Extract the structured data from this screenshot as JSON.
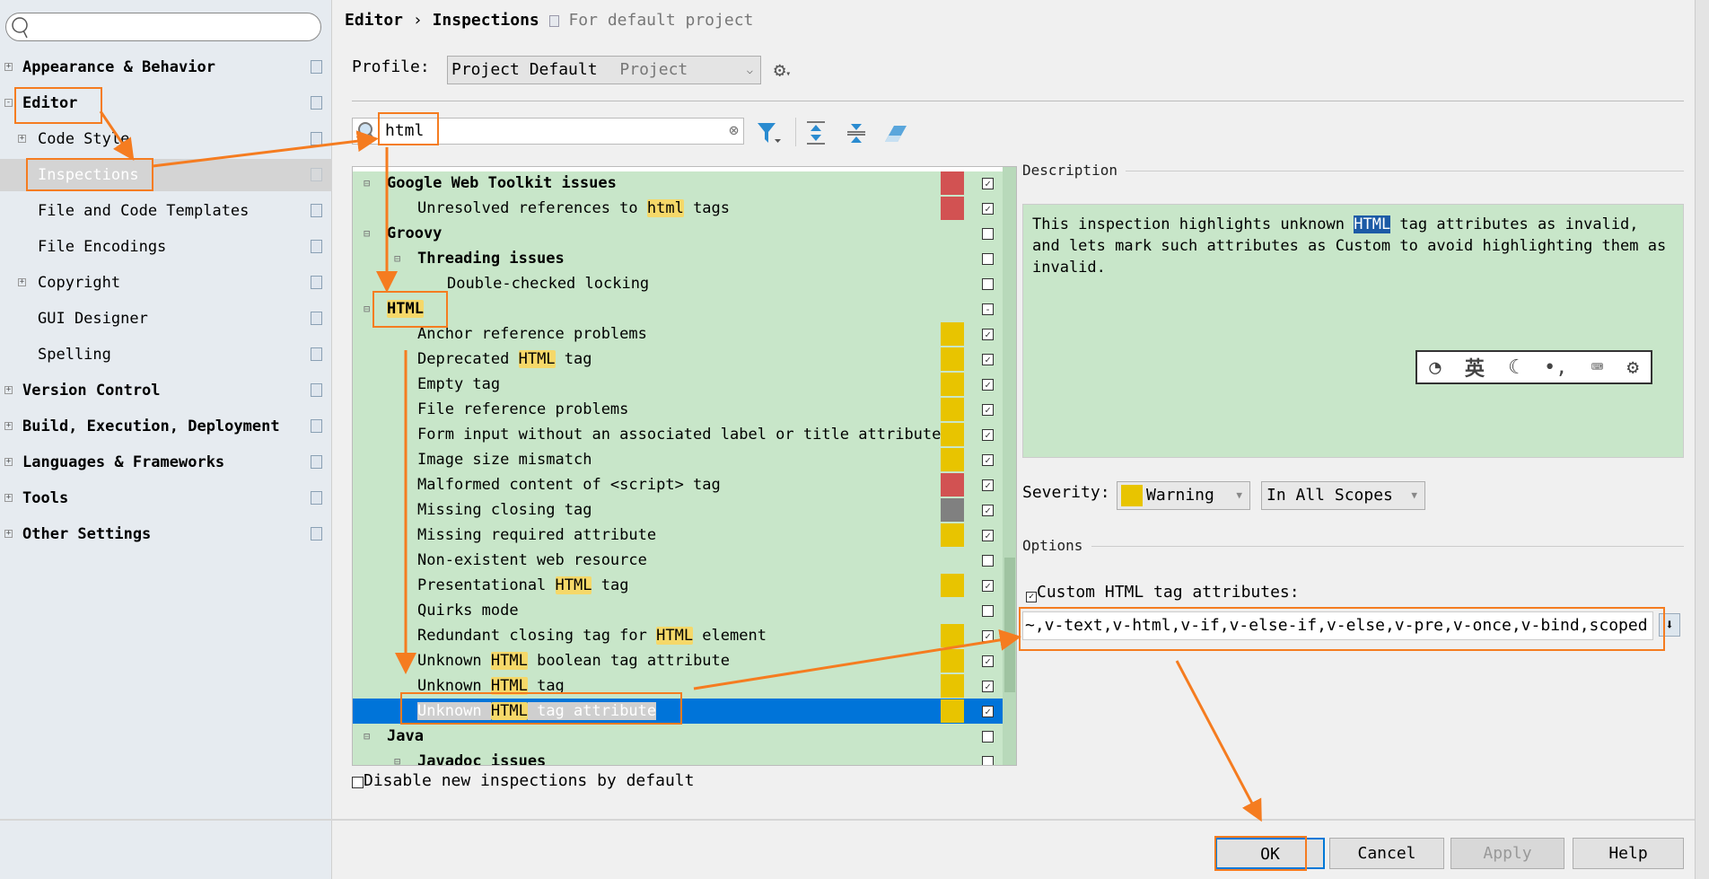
{
  "sidebar": {
    "search_placeholder": "",
    "items": [
      {
        "label": "Appearance & Behavior",
        "level": 0,
        "expander": "+"
      },
      {
        "label": "Editor",
        "level": 0,
        "expander": "-"
      },
      {
        "label": "Code Style",
        "level": 1,
        "expander": "+"
      },
      {
        "label": "Inspections",
        "level": 1,
        "expander": "",
        "selected": true
      },
      {
        "label": "File and Code Templates",
        "level": 1,
        "expander": ""
      },
      {
        "label": "File Encodings",
        "level": 1,
        "expander": ""
      },
      {
        "label": "Copyright",
        "level": 1,
        "expander": "+"
      },
      {
        "label": "GUI Designer",
        "level": 1,
        "expander": ""
      },
      {
        "label": "Spelling",
        "level": 1,
        "expander": ""
      },
      {
        "label": "Version Control",
        "level": 0,
        "expander": "+"
      },
      {
        "label": "Build, Execution, Deployment",
        "level": 0,
        "expander": "+"
      },
      {
        "label": "Languages & Frameworks",
        "level": 0,
        "expander": "+"
      },
      {
        "label": "Tools",
        "level": 0,
        "expander": "+"
      },
      {
        "label": "Other Settings",
        "level": 0,
        "expander": "+"
      }
    ]
  },
  "header": {
    "crumb1": "Editor",
    "sep": "›",
    "crumb2": "Inspections",
    "scope": "For default project"
  },
  "profile": {
    "label": "Profile:",
    "value": "Project Default",
    "type": "Project"
  },
  "filter": {
    "value": "html"
  },
  "colors": {
    "error": "#d25252",
    "warning": "#e8c400",
    "server": "#808080",
    "selection": "#0074d9",
    "tree_bg": "#c8e6c9",
    "annotation": "#f57c20"
  },
  "tree": [
    {
      "level": 0,
      "bold": true,
      "parts": [
        [
          "Google Web Toolkit issues",
          0
        ]
      ],
      "sev": "error",
      "check": "on"
    },
    {
      "level": 1,
      "parts": [
        [
          "Unresolved references to ",
          0
        ],
        [
          "html",
          1
        ],
        [
          " tags",
          0
        ]
      ],
      "sev": "error",
      "check": "on"
    },
    {
      "level": 0,
      "bold": true,
      "parts": [
        [
          "Groovy",
          0
        ]
      ],
      "sev": "",
      "check": "off"
    },
    {
      "level": 1,
      "bold": true,
      "parts": [
        [
          "Threading issues",
          0
        ]
      ],
      "sev": "",
      "check": "off"
    },
    {
      "level": 2,
      "parts": [
        [
          "Double-checked locking",
          0
        ]
      ],
      "sev": "",
      "check": "off"
    },
    {
      "level": 0,
      "bold": true,
      "parts": [
        [
          "HTML",
          1
        ]
      ],
      "sev": "",
      "check": "mixed"
    },
    {
      "level": 1,
      "parts": [
        [
          "Anchor reference problems",
          0
        ]
      ],
      "sev": "warning",
      "check": "on"
    },
    {
      "level": 1,
      "parts": [
        [
          "Deprecated ",
          0
        ],
        [
          "HTML",
          1
        ],
        [
          " tag",
          0
        ]
      ],
      "sev": "warning",
      "check": "on"
    },
    {
      "level": 1,
      "parts": [
        [
          "Empty tag",
          0
        ]
      ],
      "sev": "warning",
      "check": "on"
    },
    {
      "level": 1,
      "parts": [
        [
          "File reference problems",
          0
        ]
      ],
      "sev": "warning",
      "check": "on"
    },
    {
      "level": 1,
      "parts": [
        [
          "Form input without an associated label or title attribute",
          0
        ]
      ],
      "sev": "warning",
      "check": "on"
    },
    {
      "level": 1,
      "parts": [
        [
          "Image size mismatch",
          0
        ]
      ],
      "sev": "warning",
      "check": "on"
    },
    {
      "level": 1,
      "parts": [
        [
          "Malformed content of <script> tag",
          0
        ]
      ],
      "sev": "error",
      "check": "on"
    },
    {
      "level": 1,
      "parts": [
        [
          "Missing closing tag",
          0
        ]
      ],
      "sev": "server",
      "check": "on"
    },
    {
      "level": 1,
      "parts": [
        [
          "Missing required attribute",
          0
        ]
      ],
      "sev": "warning",
      "check": "on"
    },
    {
      "level": 1,
      "parts": [
        [
          "Non-existent web resource",
          0
        ]
      ],
      "sev": "",
      "check": "off"
    },
    {
      "level": 1,
      "parts": [
        [
          "Presentational ",
          0
        ],
        [
          "HTML",
          1
        ],
        [
          " tag",
          0
        ]
      ],
      "sev": "warning",
      "check": "on"
    },
    {
      "level": 1,
      "parts": [
        [
          "Quirks mode",
          0
        ]
      ],
      "sev": "",
      "check": "off"
    },
    {
      "level": 1,
      "parts": [
        [
          "Redundant closing tag for ",
          0
        ],
        [
          "HTML",
          1
        ],
        [
          " element",
          0
        ]
      ],
      "sev": "warning",
      "check": "on"
    },
    {
      "level": 1,
      "parts": [
        [
          "Unknown ",
          0
        ],
        [
          "HTML",
          1
        ],
        [
          " boolean tag attribute",
          0
        ]
      ],
      "sev": "warning",
      "check": "on"
    },
    {
      "level": 1,
      "parts": [
        [
          "Unknown ",
          0
        ],
        [
          "HTML",
          1
        ],
        [
          " tag",
          0
        ]
      ],
      "sev": "warning",
      "check": "on"
    },
    {
      "level": 1,
      "parts": [
        [
          "Unknown ",
          0
        ],
        [
          "HTML",
          1
        ],
        [
          " tag attribute",
          0
        ]
      ],
      "sev": "warning",
      "check": "on",
      "selected": true
    },
    {
      "level": 0,
      "bold": true,
      "parts": [
        [
          "Java",
          0
        ]
      ],
      "sev": "",
      "check": "off"
    },
    {
      "level": 1,
      "bold": true,
      "parts": [
        [
          "Javadoc issues",
          0
        ]
      ],
      "sev": "",
      "check": "off"
    }
  ],
  "disable_new": {
    "label": "Disable new inspections by default",
    "checked": false
  },
  "description": {
    "title": "Description",
    "pre": "This inspection highlights unknown ",
    "hl": "HTML",
    "post": " tag attributes as invalid, and lets mark such attributes as Custom to avoid highlighting them as invalid."
  },
  "ime": {
    "lang": "英"
  },
  "severity": {
    "label": "Severity:",
    "value": "Warning",
    "scope": "In All Scopes"
  },
  "options": {
    "title": "Options",
    "custom_label": "Custom HTML tag attributes:",
    "custom_checked": true,
    "custom_value": "~,v-text,v-html,v-if,v-else-if,v-else,v-pre,v-once,v-bind,scoped"
  },
  "buttons": {
    "ok": "OK",
    "cancel": "Cancel",
    "apply": "Apply",
    "help": "Help"
  }
}
